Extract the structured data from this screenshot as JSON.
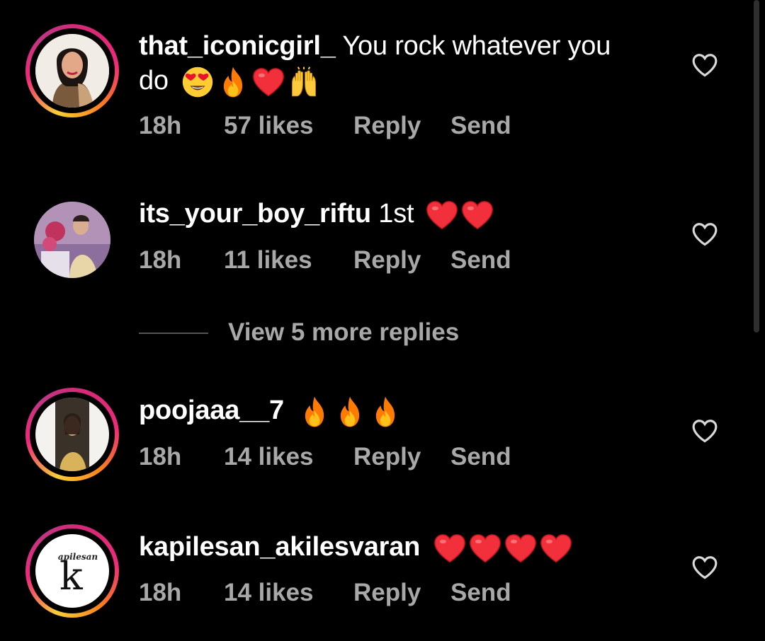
{
  "comments": [
    {
      "username": "that_iconicgirl_",
      "text_line1": "You rock whatever you",
      "text_line2": "do",
      "emojis": [
        "heart-eyes-emoji",
        "fire-emoji",
        "red-heart-emoji",
        "raising-hands-emoji"
      ],
      "time": "18h",
      "likes": "57 likes",
      "reply": "Reply",
      "send": "Send",
      "story_ring": true
    },
    {
      "username": "its_your_boy_riftu",
      "text_line1": "1st",
      "emojis": [
        "red-heart-emoji",
        "red-heart-emoji"
      ],
      "time": "18h",
      "likes": "11 likes",
      "reply": "Reply",
      "send": "Send",
      "story_ring": false
    },
    {
      "username": "poojaaa__7",
      "text_line1": "",
      "emojis": [
        "fire-emoji",
        "fire-emoji",
        "fire-emoji"
      ],
      "time": "18h",
      "likes": "14 likes",
      "reply": "Reply",
      "send": "Send",
      "story_ring": true
    },
    {
      "username": "kapilesan_akilesvaran",
      "text_line1": "",
      "emojis": [
        "red-heart-emoji",
        "red-heart-emoji",
        "red-heart-emoji",
        "red-heart-emoji"
      ],
      "time": "18h",
      "likes": "14 likes",
      "reply": "Reply",
      "send": "Send",
      "story_ring": true,
      "avatar_logo_text": "apilesan",
      "avatar_logo_letter": "k"
    }
  ],
  "view_more_replies": "View 5 more replies",
  "colors": {
    "background": "#000000",
    "meta_text": "#a8a8a8",
    "heart_red": "#f2303b",
    "fire_orange": "#ff8a00"
  }
}
